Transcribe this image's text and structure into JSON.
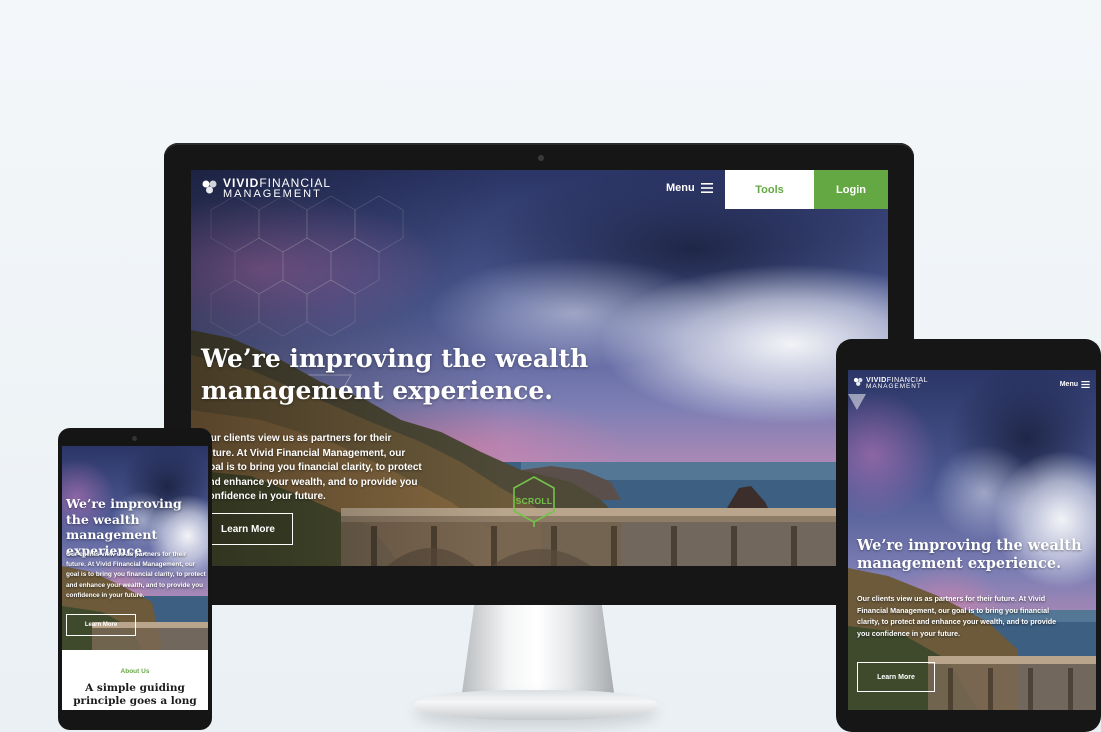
{
  "brand": {
    "name_bold": "VIVID",
    "name_light": "FINANCIAL",
    "tagline": "MANAGEMENT",
    "accent_green": "#64a843",
    "logo_icon": "vivid-logo-mark-icon"
  },
  "desktop": {
    "menu_label": "Menu",
    "menu_icon": "hamburger-icon",
    "tools_label": "Tools",
    "login_label": "Login",
    "hero_title": "We’re improving the wealth management experience.",
    "hero_body": "Our clients view us as partners for their future. At Vivid Financial Management, our goal is to bring you financial clarity, to protect and enhance your wealth, and to provide you confidence in your future.",
    "learn_more_label": "Learn More",
    "scroll_label": "SCROLL"
  },
  "phone": {
    "hero_title": "We’re improving the wealth management experience.",
    "hero_body": "Our clients view us as partners for their future. At Vivid Financial Management, our goal is to bring you financial clarity, to protect and enhance your wealth, and to provide you confidence in your future.",
    "learn_more_label": "Learn More",
    "about_label": "About Us",
    "about_heading": "A simple guiding principle goes a long"
  },
  "tablet": {
    "menu_label": "Menu",
    "menu_icon": "hamburger-icon",
    "hero_title": "We’re improving the wealth management experience.",
    "hero_body": "Our clients view us as partners for their future. At Vivid Financial Management, our goal is to bring you financial clarity, to protect and enhance your wealth, and to provide you confidence in your future.",
    "learn_more_label": "Learn More"
  }
}
